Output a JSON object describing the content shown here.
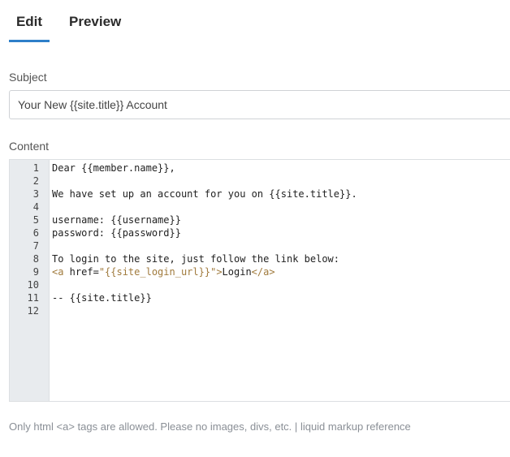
{
  "tabs": {
    "edit": "Edit",
    "preview": "Preview",
    "active": "Edit"
  },
  "subject": {
    "label": "Subject",
    "value": "Your New {{site.title}} Account"
  },
  "content": {
    "label": "Content",
    "lines": [
      {
        "n": "1",
        "text": "Dear {{member.name}},"
      },
      {
        "n": "2",
        "text": ""
      },
      {
        "n": "3",
        "text": "We have set up an account for you on {{site.title}}."
      },
      {
        "n": "4",
        "text": ""
      },
      {
        "n": "5",
        "text": "username: {{username}}"
      },
      {
        "n": "6",
        "text": "password: {{password}}"
      },
      {
        "n": "7",
        "text": ""
      },
      {
        "n": "8",
        "text": "To login to the site, just follow the link below:"
      },
      {
        "n": "9",
        "text": "<a href=\"{{site_login_url}}\">Login</a>",
        "parts": {
          "open": "<a",
          "attr": " href=",
          "val": "\"{{site_login_url}}\"",
          "close1": ">",
          "inner": "Login",
          "close2": "</a>"
        }
      },
      {
        "n": "10",
        "text": ""
      },
      {
        "n": "11",
        "text": "-- {{site.title}}"
      },
      {
        "n": "12",
        "text": ""
      }
    ]
  },
  "help": {
    "text": "Only html <a> tags are allowed. Please no images, divs, etc.",
    "separator": "|",
    "link": "liquid markup reference"
  },
  "colors": {
    "accent": "#2e7fc9",
    "tag": "#a07a3c",
    "gutter": "#e8ebee"
  }
}
